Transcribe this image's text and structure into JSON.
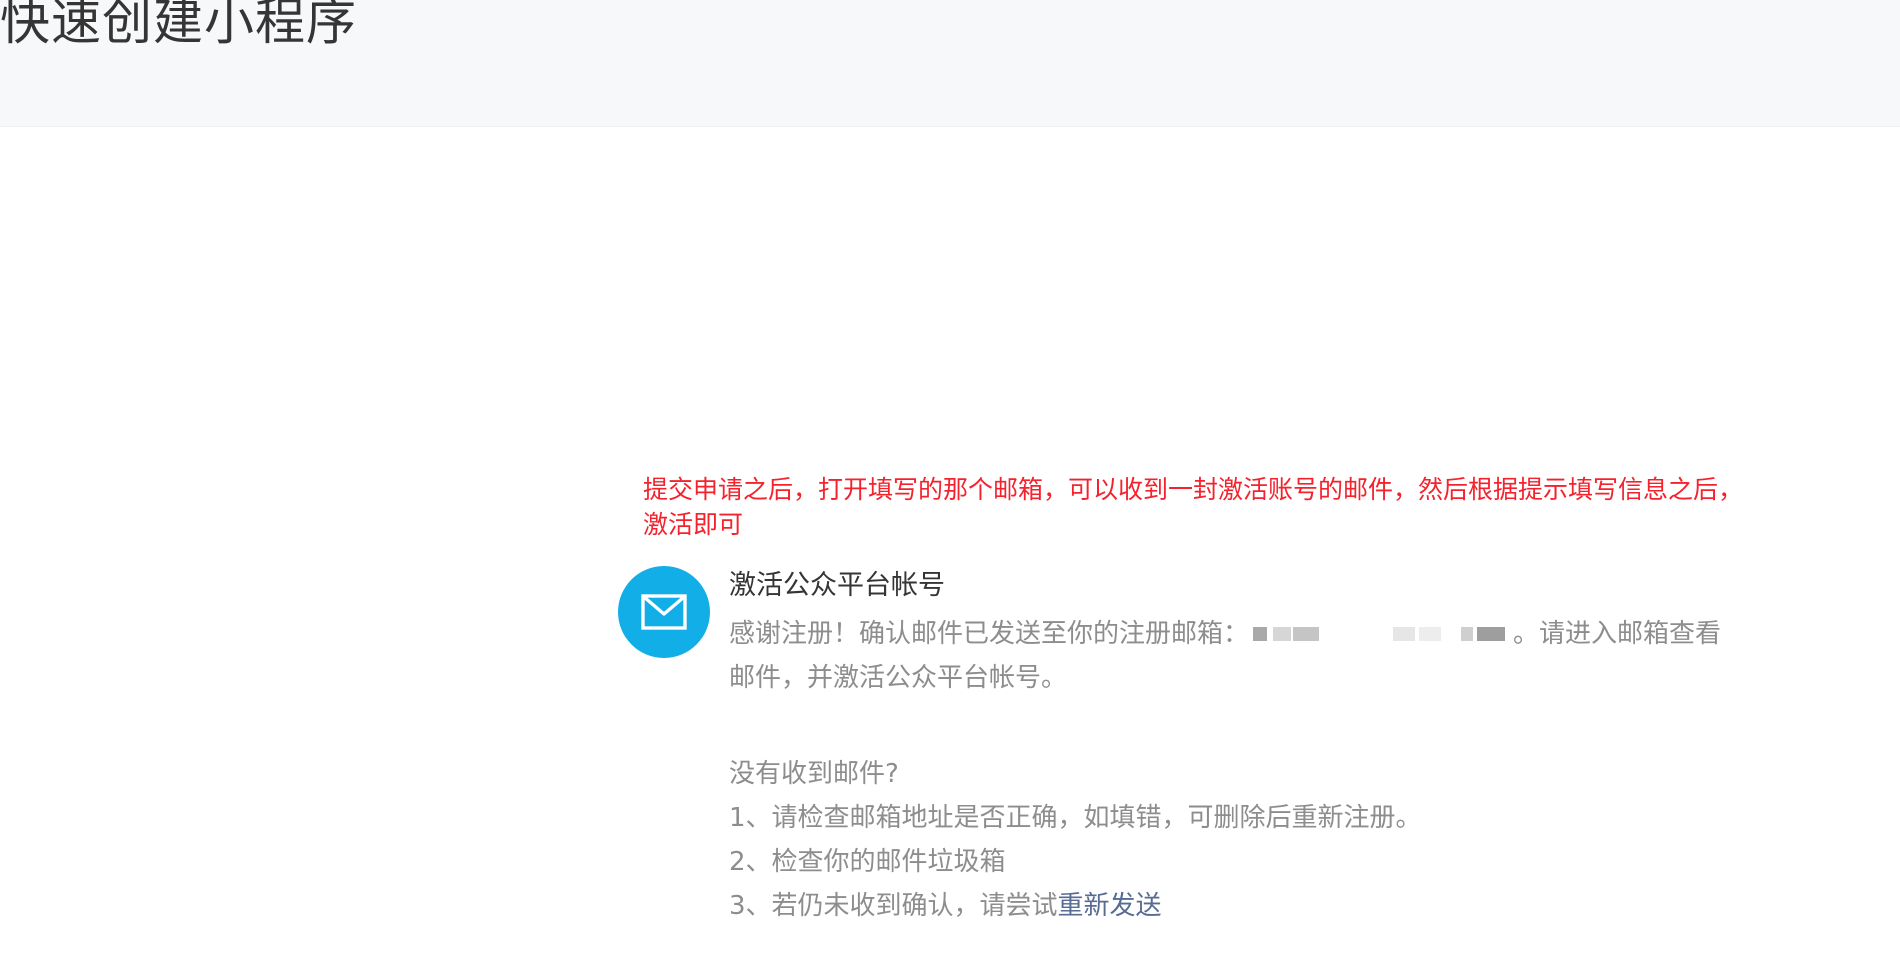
{
  "header": {
    "title": "快速创建小程序"
  },
  "note": {
    "line1": "提交申请之后，打开填写的那个邮箱，可以收到一封激活账号的邮件，然后根据提示填写信息之后，",
    "line2": "激活即可"
  },
  "activation": {
    "icon": "mail-icon",
    "icon_color": "#11aee8",
    "title": "激活公众平台帐号",
    "desc_prefix": "感谢注册！确认邮件已发送至你的注册邮箱：",
    "desc_suffix": "。请进入邮箱查看",
    "desc_line2": "邮件，并激活公众平台帐号。"
  },
  "help": {
    "heading": "没有收到邮件?",
    "step1": "1、请检查邮箱地址是否正确，如填错，可删除后重新注册。",
    "step2": "2、检查你的邮件垃圾箱",
    "step3_prefix": "3、若仍未收到确认，请尝试",
    "resend_link": "重新发送"
  },
  "colors": {
    "note_red": "#f5222d",
    "link_blue": "#576b95",
    "text_dark": "#353535",
    "text_gray": "#8d8d8d"
  }
}
